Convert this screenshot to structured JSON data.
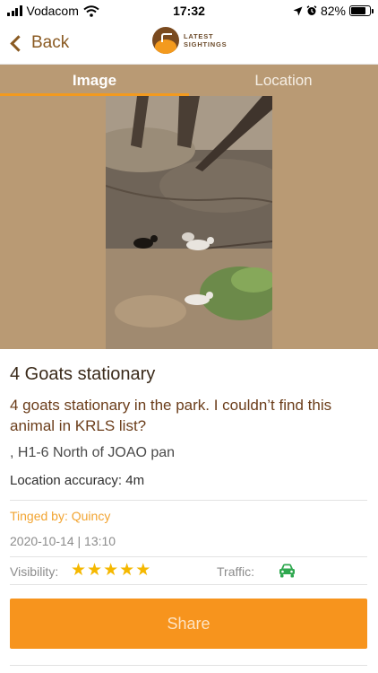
{
  "status_bar": {
    "carrier": "Vodacom",
    "time": "17:32",
    "battery_percent": "82%",
    "battery_level": 0.82,
    "icons": [
      "signal-icon",
      "wifi-icon",
      "location-arrow-icon",
      "alarm-icon",
      "battery-icon"
    ]
  },
  "nav": {
    "back_label": "Back",
    "logo_line1": "LATEST",
    "logo_line2": "SIGHTINGS"
  },
  "tabs": [
    {
      "label": "Image",
      "active": true
    },
    {
      "label": "Location",
      "active": false
    }
  ],
  "sighting": {
    "title": "4 Goats stationary",
    "description": "4 goats stationary in the park. I couldn’t find this animal in KRLS list?",
    "area": ", H1-6 North of JOAO pan",
    "location_accuracy": "Location accuracy: 4m",
    "tinged_by": "Tinged by: Quincy",
    "datetime": "2020-10-14 | 13:10",
    "visibility_label": "Visibility:",
    "visibility_rating": 5,
    "visibility_max": 5,
    "traffic_label": "Traffic:",
    "traffic_icon": "car-icon",
    "share_label": "Share"
  },
  "colors": {
    "brand_orange": "#f7941d",
    "tab_background": "#b99a74",
    "accent_brown": "#8a5a22",
    "star": "#f5b800",
    "traffic_green": "#2fa84f"
  }
}
